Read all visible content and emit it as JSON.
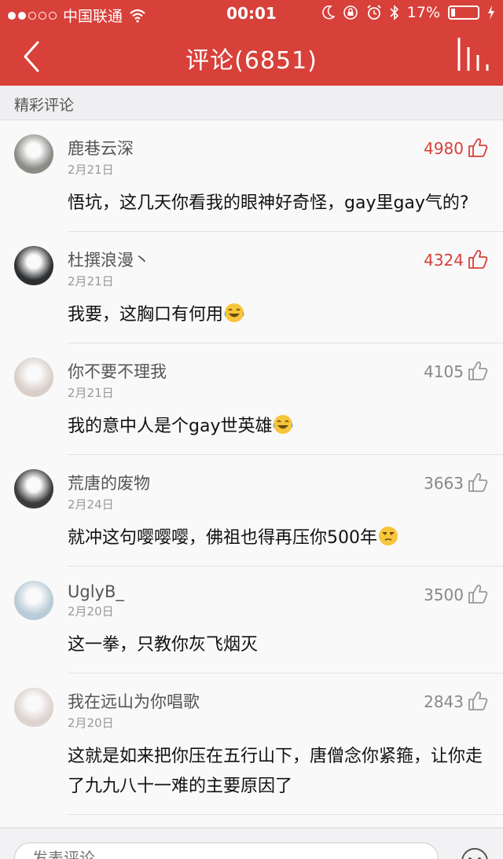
{
  "status_bar": {
    "carrier": "中国联通",
    "time": "00:01",
    "battery": "17%",
    "signal_bars_filled": 2,
    "signal_bars_total": 5,
    "battery_level": 0.17
  },
  "nav": {
    "title": "评论(6851)"
  },
  "section": {
    "label": "精彩评论"
  },
  "colors": {
    "brand": "#d8403a",
    "background": "#f9f9fa"
  },
  "comments": [
    {
      "user": "鹿巷云深",
      "date": "2月21日",
      "likes": "4980",
      "hot": true,
      "text": "悟坑，这几天你看我的眼神好奇怪，gay里gay气的?",
      "emoji": ""
    },
    {
      "user": "杜撰浪漫丶",
      "date": "2月21日",
      "likes": "4324",
      "hot": true,
      "text": "我要，这胸口有何用",
      "emoji": "laugh-cry-emoji"
    },
    {
      "user": "你不要不理我",
      "date": "2月21日",
      "likes": "4105",
      "hot": false,
      "text": "我的意中人是个gay世英雄",
      "emoji": "laugh-cry-emoji"
    },
    {
      "user": "荒唐的废物",
      "date": "2月24日",
      "likes": "3663",
      "hot": false,
      "text": "就冲这句嘤嘤嘤，佛祖也得再压你500年",
      "emoji": "unamused-emoji"
    },
    {
      "user": "UglyB_",
      "date": "2月20日",
      "likes": "3500",
      "hot": false,
      "text": "这一拳，只教你灰飞烟灭",
      "emoji": ""
    },
    {
      "user": "我在远山为你唱歌",
      "date": "2月20日",
      "likes": "2843",
      "hot": false,
      "text": "这就是如来把你压在五行山下，唐僧念你紧箍，让你走了九九八十一难的主要原因了",
      "emoji": ""
    }
  ],
  "bottom": {
    "input_placeholder": "发表评论"
  }
}
